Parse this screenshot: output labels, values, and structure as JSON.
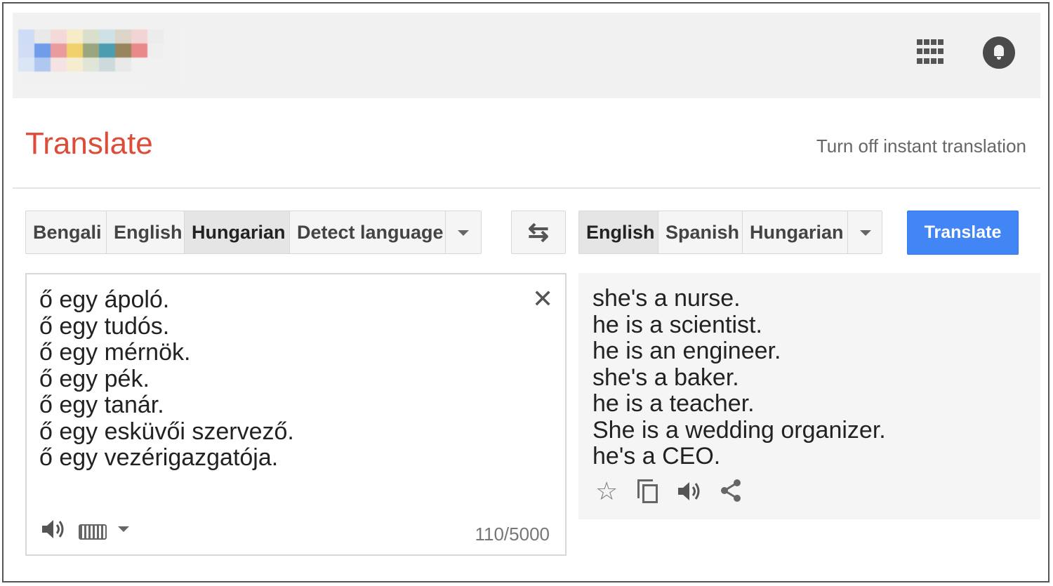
{
  "header": {
    "logo_colors": [
      "#c9d9f7",
      "#e8e8e8",
      "#f4d5d6",
      "#f7ecc0",
      "#d6dcc6",
      "#c8dfe3",
      "#d8cfc0",
      "#f4cfcf",
      "#ececec",
      "#f1f1f1",
      "#cbdaf6",
      "#5a8ee8",
      "#e98d8f",
      "#f1cc55",
      "#8d9a6c",
      "#2f8fa4",
      "#8a7344",
      "#e97777",
      "#efefef",
      "#f1f1f1",
      "#d7e3f8",
      "#a5c2f1",
      "#f6e0e0",
      "#f8eccb",
      "#dfe4d4",
      "#c7d7da",
      "#e8e8e8",
      "#f1f1f1",
      "#f1f1f1",
      "#f1f1f1",
      "#f2f2f2",
      "#f2f2f2",
      "#f2f2f2",
      "#f2f2f2",
      "#f2f2f2",
      "#f2f2f2",
      "#f2f2f2",
      "#f2f2f2",
      "#f1f1f1",
      "#f1f1f1"
    ],
    "apps_icon": "apps-grid-icon",
    "notifications_icon": "bell-icon"
  },
  "page": {
    "title": "Translate",
    "instant_link": "Turn off instant translation",
    "title_color": "#dd4b39",
    "accent_color": "#4285f4"
  },
  "source_langs": [
    {
      "label": "Bengali",
      "selected": false
    },
    {
      "label": "English",
      "selected": false
    },
    {
      "label": "Hungarian",
      "selected": true
    },
    {
      "label": "Detect language",
      "selected": false
    }
  ],
  "target_langs": [
    {
      "label": "English",
      "selected": true
    },
    {
      "label": "Spanish",
      "selected": false
    },
    {
      "label": "Hungarian",
      "selected": false
    }
  ],
  "swap_icon": "swap-languages-icon",
  "translate_button": "Translate",
  "source": {
    "text": "ő egy ápoló.\nő egy tudós.\nő egy mérnök.\nő egy pék.\nő egy tanár.\nő egy esküvői szervező.\nő egy vezérigazgatója.",
    "counter": "110/5000"
  },
  "target": {
    "text": "she's a nurse.\nhe is a scientist.\nhe is an engineer.\nshe's a baker.\nhe is a teacher.\nShe is a wedding organizer.\nhe's a CEO."
  }
}
